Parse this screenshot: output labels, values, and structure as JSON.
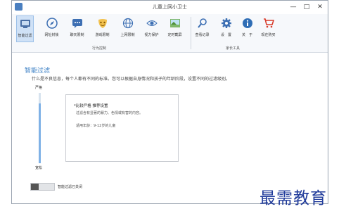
{
  "window": {
    "title": "儿童上网小卫士"
  },
  "toolbar": {
    "group1_label": "行为控制",
    "group2_label": "家长工具",
    "items": [
      {
        "label": "智能过滤",
        "icon": "filter-icon"
      },
      {
        "label": "网址封锁",
        "icon": "compass-icon"
      },
      {
        "label": "聊天限制",
        "icon": "chat-icon"
      },
      {
        "label": "游戏限制",
        "icon": "mask-icon"
      },
      {
        "label": "上网限制",
        "icon": "globe-icon"
      },
      {
        "label": "视力保护",
        "icon": "eye-icon"
      },
      {
        "label": "定时截屏",
        "icon": "picture-icon"
      },
      {
        "label": "查看记录",
        "icon": "search-icon"
      },
      {
        "label": "设　置",
        "icon": "gear-icon"
      },
      {
        "label": "关　于",
        "icon": "info-icon"
      },
      {
        "label": "现在购买",
        "icon": "cart-icon"
      }
    ]
  },
  "main": {
    "heading": "智能过滤",
    "description": "什么是不良信息，每个人都有不同的标准。您可以根据自身情况和孩子的年龄阶段，设置不同的过滤级别。",
    "level_top": "严格",
    "level_bottom": "宽松",
    "level_fraction": 0.85,
    "card": {
      "title": "*比较严格 推荐设置",
      "line1": "过滤含有显著的暴力、色情或有害的内容。",
      "line2": "适用年龄：9-12岁的儿童"
    },
    "toggle_label": "智能过滤已关闭"
  },
  "watermark": "最需教育",
  "colors": {
    "accent": "#3b7fc4",
    "watermark": "#1f3a9a"
  }
}
